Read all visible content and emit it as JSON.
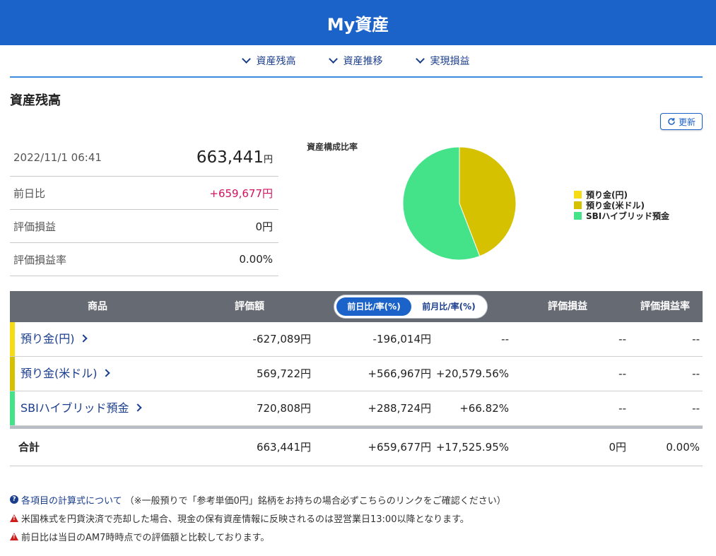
{
  "header": {
    "title": "My資産"
  },
  "subnav": [
    {
      "label": "資産残高"
    },
    {
      "label": "資産推移"
    },
    {
      "label": "実現損益"
    }
  ],
  "section": {
    "title": "資産残高",
    "refresh_label": "更新"
  },
  "summary": {
    "timestamp": "2022/11/1 06:41",
    "total_value": "663,441",
    "total_unit": "円",
    "rows": [
      {
        "label": "前日比",
        "value": "+659,677円"
      },
      {
        "label": "評価損益",
        "value": "0円"
      },
      {
        "label": "評価損益率",
        "value": "0.00%"
      }
    ]
  },
  "chart_data": {
    "type": "pie",
    "title": "資産構成比率",
    "labels": [
      "預り金(円)",
      "預り金(米ドル)",
      "SBIハイブリッド預金"
    ],
    "values": [
      0,
      569722,
      720808
    ],
    "colors": [
      "#f5dc14",
      "#d6c100",
      "#44e38a"
    ],
    "legend": "right"
  },
  "table": {
    "headers": {
      "product": "商品",
      "valuation": "評価額",
      "toggle_day": "前日比/率(%)",
      "toggle_month": "前月比/率(%)",
      "pl": "評価損益",
      "pl_rate": "評価損益率"
    },
    "rows": [
      {
        "name": "預り金(円)",
        "color": "#f5dc14",
        "valuation": "-627,089円",
        "change": "-196,014円",
        "change_rate": "--",
        "pl": "--",
        "pl_rate": "--",
        "change_sign": "minus"
      },
      {
        "name": "預り金(米ドル)",
        "color": "#d6c100",
        "valuation": "569,722円",
        "change": "+566,967円",
        "change_rate": "+20,579.56%",
        "pl": "--",
        "pl_rate": "--",
        "change_sign": "plus"
      },
      {
        "name": "SBIハイブリッド預金",
        "color": "#44e38a",
        "valuation": "720,808円",
        "change": "+288,724円",
        "change_rate": "+66.82%",
        "pl": "--",
        "pl_rate": "--",
        "change_sign": "plus"
      }
    ],
    "total": {
      "label": "合計",
      "valuation": "663,441円",
      "change": "+659,677円",
      "change_rate": "+17,525.95%",
      "pl": "0円",
      "pl_rate": "0.00%"
    }
  },
  "notes": {
    "link": "各項目の計算式について",
    "link_suffix": "（※一般預りで「参考単価0円」銘柄をお持ちの場合必ずこちらのリンクをご確認ください）",
    "warning1": "米国株式を円貨決済で売却した場合、現金の保有資産情報に反映されるのは翌営業日13:00以降となります。",
    "warning2": "前日比は当日のAM7時時点での評価額と比較しております。"
  }
}
